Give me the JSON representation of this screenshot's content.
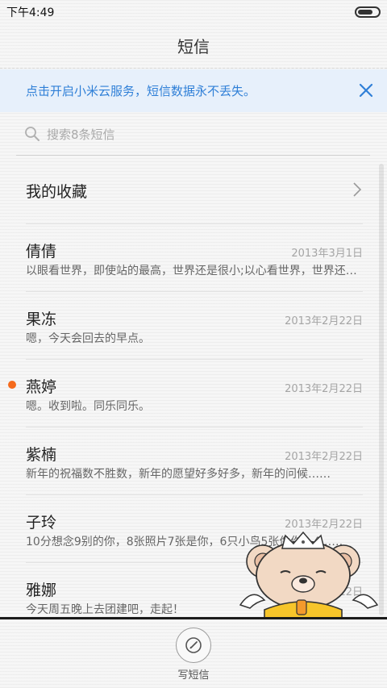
{
  "status_bar": {
    "time": "下午4:49",
    "battery_level": 0.9
  },
  "header": {
    "title": "短信"
  },
  "banner": {
    "text": "点击开启小米云服务，短信数据永不丢失。",
    "close_icon": "close-icon",
    "accent_color": "#2f7fd7"
  },
  "search": {
    "placeholder": "搜索8条短信",
    "icon": "search-icon"
  },
  "favorites": {
    "label": "我的收藏",
    "icon": "chevron-right-icon"
  },
  "conversations": [
    {
      "name": "倩倩",
      "date": "2013年3月1日",
      "preview": "以眼看世界，即使站的最高，世界还是很小;以心看世界，世界还是很大……",
      "unread": false
    },
    {
      "name": "果冻",
      "date": "2013年2月22日",
      "preview": "嗯，今天会回去的早点。",
      "unread": false
    },
    {
      "name": "燕婷",
      "date": "2013年2月22日",
      "preview": "嗯。收到啦。同乐同乐。",
      "unread": true
    },
    {
      "name": "紫楠",
      "date": "2013年2月22日",
      "preview": "新年的祝福数不胜数，新年的愿望好多好多，新年的问候……",
      "unread": false
    },
    {
      "name": "子玲",
      "date": "2013年2月22日",
      "preview": "10分想念9别的你，8张照片7张是你，6只小鸟5张像你，4……",
      "unread": false
    },
    {
      "name": "雅娜",
      "date": "2013年2月22日",
      "preview": "今天周五晚上去团建吧，走起！",
      "unread": false
    }
  ],
  "colors": {
    "unread_dot": "#f56a1c"
  },
  "bottom_bar": {
    "compose_label": "写短信",
    "compose_icon": "compose-icon"
  },
  "decoration": {
    "mascot": "teddy-bear-with-crown-sticker"
  }
}
